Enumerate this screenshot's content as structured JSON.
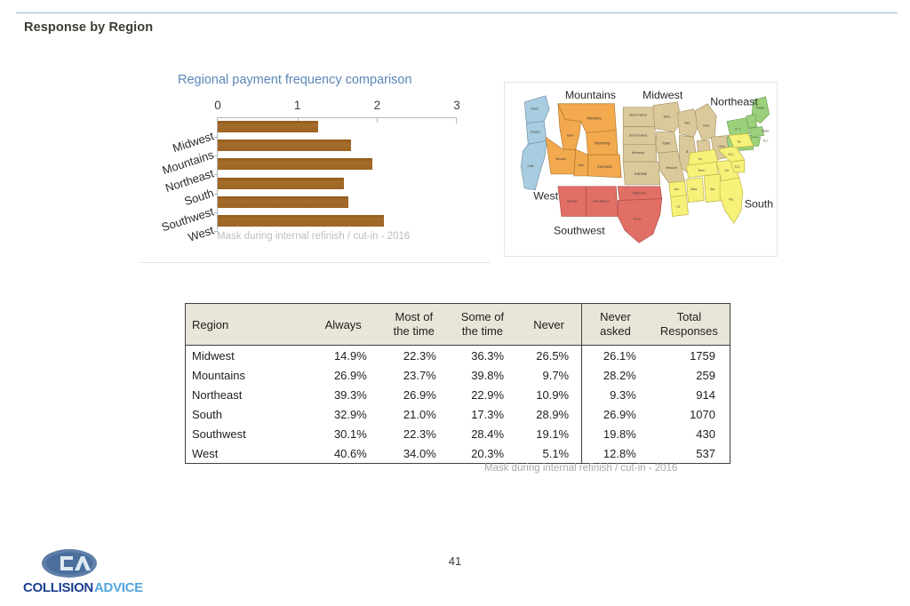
{
  "slide": {
    "title": "Response by Region",
    "page_number": "41",
    "rule_color": "#9cb8d4"
  },
  "chart_data": {
    "type": "bar",
    "orientation": "horizontal",
    "title": "Regional payment frequency comparison",
    "title_color": "#5b87b8",
    "bar_color": "#9c6526",
    "categories": [
      "Midwest",
      "Mountains",
      "Northeast",
      "South",
      "Southwest",
      "West"
    ],
    "values": [
      1.26,
      1.67,
      1.94,
      1.58,
      1.64,
      2.09
    ],
    "xlabel": "",
    "ylabel": "",
    "xlim": [
      0,
      3
    ],
    "xticks": [
      "0",
      "1",
      "2",
      "3"
    ],
    "grid": false,
    "legend": false,
    "caption": "Mask during internal refinish / cut-in - 2016"
  },
  "map": {
    "regions": [
      {
        "name": "West",
        "color": "#a8cde0"
      },
      {
        "name": "Mountains",
        "color": "#f3a94e"
      },
      {
        "name": "Midwest",
        "color": "#dbc99c"
      },
      {
        "name": "Northeast",
        "color": "#9bd17b"
      },
      {
        "name": "Southwest",
        "color": "#e16f66"
      },
      {
        "name": "South",
        "color": "#f6f178"
      }
    ],
    "labels": {
      "west": "West",
      "mountains": "Mountains",
      "midwest": "Midwest",
      "northeast": "Northeast",
      "southwest": "Southwest",
      "south": "South"
    },
    "states": {
      "wash": "Wash.",
      "oregon": "Oregon",
      "calif": "Calif.",
      "nevada": "Nevada",
      "idaho": "Idaho",
      "montana": "Montana",
      "wyoming": "Wyoming",
      "utah": "Utah",
      "colorado": "Colorado",
      "north_dakota": "North Dakota",
      "south_dakota": "South Dakota",
      "nebraska": "Nebraska",
      "kansas": "Kansas",
      "minn": "Minn.",
      "iowa": "Iowa",
      "wis": "Wis.",
      "ill": "Ill.",
      "mich": "Mich.",
      "ind": "Ind.",
      "ohio": "Ohio",
      "missouri": "Missouri",
      "arizona": "Arizona",
      "new_mexico": "New Mexico",
      "oklahoma": "Oklahoma",
      "texas": "Texas",
      "ny": "N. Y.",
      "penn": "Penn.",
      "maine": "Maine",
      "vt": "Vt.",
      "nh": "N.H.",
      "mass": "Mass.",
      "ct": "Ct.",
      "ri": "R.I.",
      "nj": "N.J.",
      "del": "Del.",
      "md": "Md.",
      "wva": "W. Va.",
      "va": "Va.",
      "ky": "Ky.",
      "tenn": "Tenn.",
      "nc": "N.C.",
      "sc": "S.C.",
      "ga": "Ga.",
      "ala": "Ala.",
      "miss": "Miss.",
      "ark": "Ark.",
      "la": "La.",
      "fla": "Fla."
    }
  },
  "table": {
    "headers": {
      "region": "Region",
      "always": "Always",
      "most_line1": "Most of",
      "most_line2": "the time",
      "some_line1": "Some of",
      "some_line2": "the time",
      "never": "Never",
      "never_asked_line1": "Never",
      "never_asked_line2": "asked",
      "total_line1": "Total",
      "total_line2": "Responses"
    },
    "rows": [
      {
        "region": "Midwest",
        "always": "14.9%",
        "most": "22.3%",
        "some": "36.3%",
        "never": "26.5%",
        "never_asked": "26.1%",
        "total": "1759"
      },
      {
        "region": "Mountains",
        "always": "26.9%",
        "most": "23.7%",
        "some": "39.8%",
        "never": "9.7%",
        "never_asked": "28.2%",
        "total": "259"
      },
      {
        "region": "Northeast",
        "always": "39.3%",
        "most": "26.9%",
        "some": "22.9%",
        "never": "10.9%",
        "never_asked": "9.3%",
        "total": "914"
      },
      {
        "region": "South",
        "always": "32.9%",
        "most": "21.0%",
        "some": "17.3%",
        "never": "28.9%",
        "never_asked": "26.9%",
        "total": "1070"
      },
      {
        "region": "Southwest",
        "always": "30.1%",
        "most": "22.3%",
        "some": "28.4%",
        "never": "19.1%",
        "never_asked": "19.8%",
        "total": "430"
      },
      {
        "region": "West",
        "always": "40.6%",
        "most": "34.0%",
        "some": "20.3%",
        "never": "5.1%",
        "never_asked": "12.8%",
        "total": "537"
      }
    ],
    "caption": "Mask during internal refinish / cut-in - 2016"
  },
  "logo": {
    "word_primary": "COLLISION",
    "word_secondary": "ADVICE",
    "monogram": "CA"
  }
}
